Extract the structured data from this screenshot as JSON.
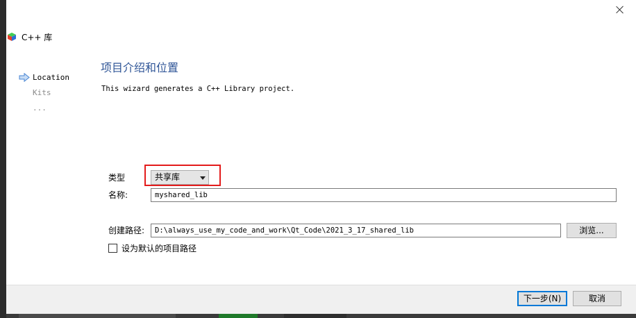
{
  "window": {
    "title": "C++ 库"
  },
  "sidebar": {
    "steps": [
      {
        "label": "Location",
        "active": true
      },
      {
        "label": "Kits",
        "active": false
      },
      {
        "label": "...",
        "active": false
      }
    ]
  },
  "page": {
    "title": "项目介绍和位置",
    "intro": "This wizard generates a C++ Library project."
  },
  "form": {
    "type_label": "类型",
    "type_value": "共享库",
    "name_label": "名称:",
    "name_value": "myshared_lib",
    "path_label": "创建路径:",
    "path_value": "D:\\always_use_my_code_and_work\\Qt_Code\\2021_3_17_shared_lib",
    "browse_label": "浏览...",
    "default_path_label": "设为默认的项目路径",
    "default_path_checked": false
  },
  "footer": {
    "next_label": "下一步(N)",
    "cancel_label": "取消"
  },
  "colors": {
    "title_blue": "#2f5597",
    "highlight_red": "#e31b1b",
    "primary_border": "#0078d7"
  }
}
